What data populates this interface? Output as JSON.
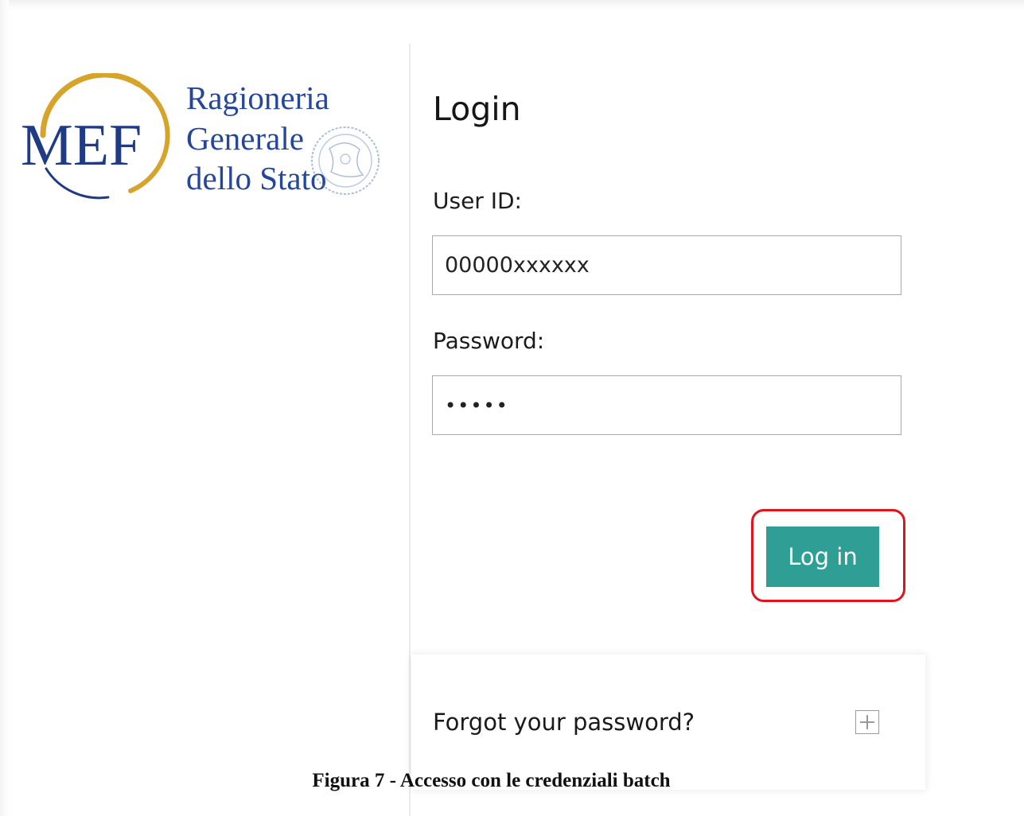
{
  "logo": {
    "mark": "MEF",
    "lines": [
      "Ragioneria",
      "Generale",
      "dello Stato"
    ],
    "ring_color": "#d6a42a",
    "text_color": "#1f3b86"
  },
  "login": {
    "title": "Login",
    "user_label": "User ID:",
    "user_value": "00000xxxxxx",
    "password_label": "Password:",
    "password_value": "•••••",
    "button_label": "Log in",
    "button_color": "#2f9e95",
    "highlight_color": "#e0141b"
  },
  "forgot": {
    "label": "Forgot your password?",
    "icon": "plus-square-icon"
  },
  "caption": "Figura 7 - Accesso con le credenziali batch"
}
